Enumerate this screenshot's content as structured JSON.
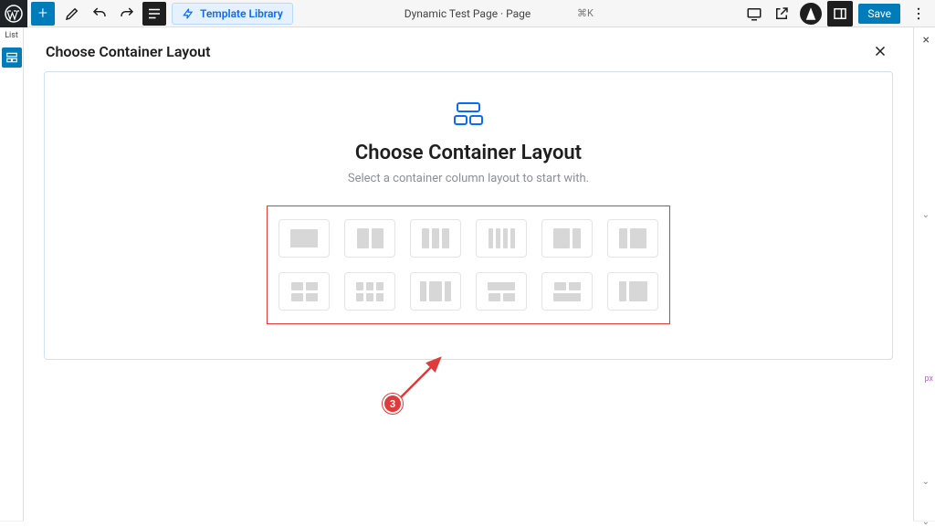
{
  "topbar": {
    "template_library_label": "Template Library",
    "doc_title": "Dynamic Test Page · Page",
    "cmdk": "⌘K",
    "save_label": "Save"
  },
  "left_strip": {
    "list_label": "List"
  },
  "right_strip": {
    "px_label": "px"
  },
  "modal": {
    "header": "Choose Container Layout",
    "hero_title": "Choose Container Layout",
    "subtitle": "Select a container column layout to start with.",
    "layouts_row1": [
      {
        "name": "layout-1col",
        "variant": "v1"
      },
      {
        "name": "layout-2col",
        "variant": "v2"
      },
      {
        "name": "layout-3col",
        "variant": "v3"
      },
      {
        "name": "layout-4col",
        "variant": "v4"
      },
      {
        "name": "layout-2col-wide-left",
        "variant": "v5"
      },
      {
        "name": "layout-2col-wide-right",
        "variant": "v6"
      }
    ],
    "layouts_row2": [
      {
        "name": "layout-grid-2x2",
        "variant": "v7"
      },
      {
        "name": "layout-grid-3x2",
        "variant": "v8"
      },
      {
        "name": "layout-3col-center",
        "variant": "v9"
      },
      {
        "name": "layout-top-split",
        "variant": "v10"
      },
      {
        "name": "layout-bottom-split",
        "variant": "v11"
      },
      {
        "name": "layout-sidebar",
        "variant": "v12"
      }
    ]
  },
  "annotation": {
    "step_number": "3"
  },
  "colors": {
    "accent": "#007cba",
    "hero_icon": "#0a6cf5",
    "annotation_red": "#e03a3a"
  }
}
